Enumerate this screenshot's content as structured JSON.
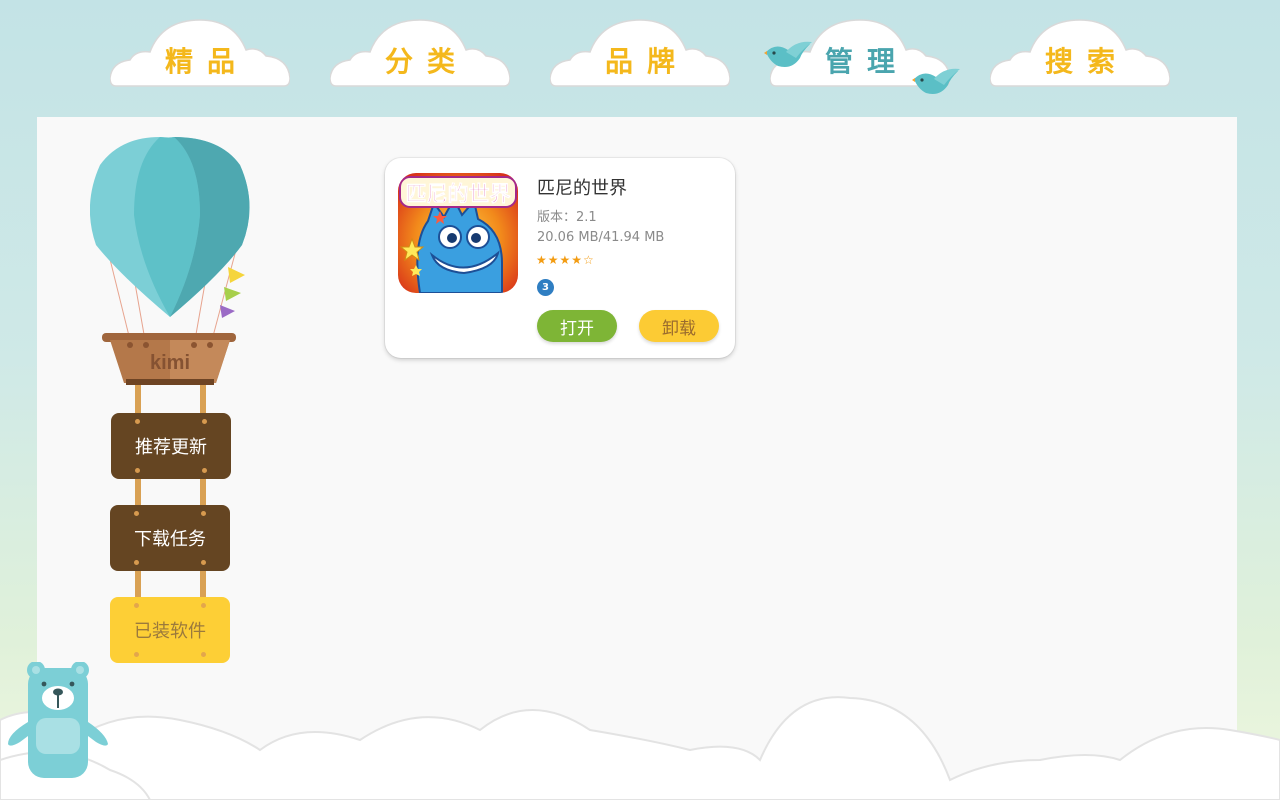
{
  "nav": {
    "tabs": [
      {
        "id": "featured",
        "label": "精品",
        "active": false
      },
      {
        "id": "category",
        "label": "分类",
        "active": false
      },
      {
        "id": "brand",
        "label": "品牌",
        "active": false
      },
      {
        "id": "manage",
        "label": "管理",
        "active": true
      },
      {
        "id": "search",
        "label": "搜索",
        "active": false
      }
    ]
  },
  "sidebar": {
    "logo_text": "kimi",
    "items": [
      {
        "label": "推荐更新",
        "active": false
      },
      {
        "label": "下载任务",
        "active": false
      },
      {
        "label": "已装软件",
        "active": true
      }
    ]
  },
  "app": {
    "name": "匹尼的世界",
    "icon_text": "匹尼的世界",
    "version": "版本：2.1",
    "size": "20.06 MB/41.94 MB",
    "rating": 4,
    "rating_max": 5,
    "rating_stars": "★★★★☆",
    "badge": "3",
    "open_label": "打开",
    "uninstall_label": "卸载"
  },
  "colors": {
    "accent_yellow": "#f4b81c",
    "accent_teal": "#4aa5ae",
    "open_green": "#7eb536",
    "uninstall_yellow": "#fccb34",
    "sign_brown": "#654522"
  },
  "icons": [
    "bird-icon",
    "balloon-icon",
    "bear-icon",
    "star-icon"
  ]
}
